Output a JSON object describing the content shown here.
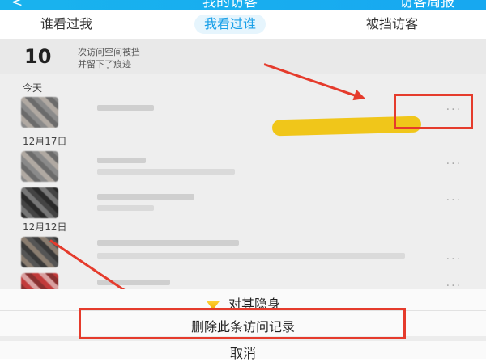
{
  "header": {
    "back_glyph": "<",
    "title": "我的访客",
    "right_label": "访客周报"
  },
  "tabs": [
    {
      "label": "谁看过我",
      "active": false
    },
    {
      "label": "我看过谁",
      "active": true
    },
    {
      "label": "被挡访客",
      "active": false
    }
  ],
  "banner": {
    "count": "10",
    "text_line1": "次访问空间被挡",
    "text_line2": "并留下了痕迹"
  },
  "sections": [
    {
      "date": "今天"
    },
    {
      "date": "12月17日"
    },
    {
      "date": "12月12日"
    }
  ],
  "row_more": "···",
  "sheet": {
    "stealth_label": "对其隐身",
    "delete_label": "删除此条访问记录",
    "cancel_label": "取消"
  },
  "colors": {
    "accent": "#1aa0e8",
    "annotation": "#e53b2c",
    "highlight": "#f0c61a"
  }
}
